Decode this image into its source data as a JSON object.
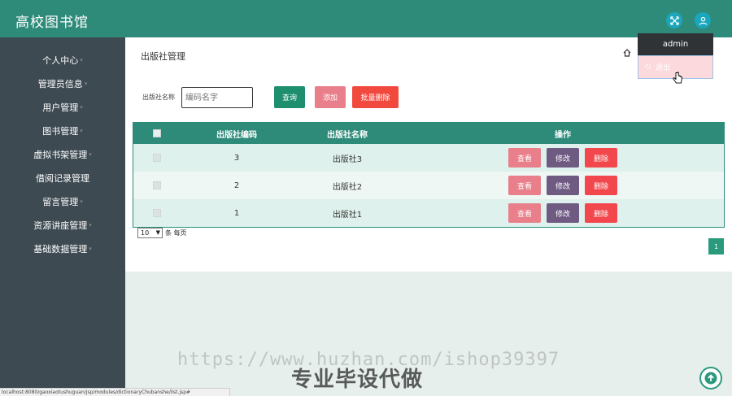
{
  "header": {
    "title": "高校图书馆"
  },
  "sidebar": {
    "items": [
      {
        "label": "个人中心",
        "caret": true
      },
      {
        "label": "管理员信息",
        "caret": true
      },
      {
        "label": "用户管理",
        "caret": true
      },
      {
        "label": "图书管理",
        "caret": true
      },
      {
        "label": "虚拟书架管理",
        "caret": true
      },
      {
        "label": "借阅记录管理",
        "caret": false
      },
      {
        "label": "留言管理",
        "caret": true
      },
      {
        "label": "资源讲座管理",
        "caret": true
      },
      {
        "label": "基础数据管理",
        "caret": true
      }
    ]
  },
  "page": {
    "title": "出版社管理"
  },
  "search": {
    "label": "出版社名称",
    "placeholder": "编码名字"
  },
  "buttons": {
    "query": "查询",
    "add": "添加",
    "batch_delete": "批量删除"
  },
  "table": {
    "columns": [
      "出版社编码",
      "出版社名称",
      "操作"
    ],
    "rows": [
      {
        "code": "3",
        "name": "出版社3"
      },
      {
        "code": "2",
        "name": "出版社2"
      },
      {
        "code": "1",
        "name": "出版社1"
      }
    ],
    "actions": {
      "view": "查看",
      "edit": "修改",
      "delete": "删除"
    }
  },
  "pagination": {
    "page_size": "10",
    "per_page_label": "条 每页",
    "current_page": "1"
  },
  "user_menu": {
    "username": "admin",
    "logout": "退出"
  },
  "watermark": {
    "url": "https://www.huzhan.com/ishop39397",
    "slogan": "专业毕设代做"
  },
  "statusbar": {
    "url": "localhost:8080/gaoxiaotushuguan/jsp/modules/dictionaryChubanshe/list.jsp#"
  },
  "colors": {
    "primary": "#2e8b7a",
    "sidebar": "#3d4a52",
    "query": "#1e8f6e",
    "add": "#e87f8a",
    "batch_delete": "#f2493f",
    "view": "#e87f8a",
    "edit": "#6f5a82",
    "delete": "#f2484d"
  }
}
